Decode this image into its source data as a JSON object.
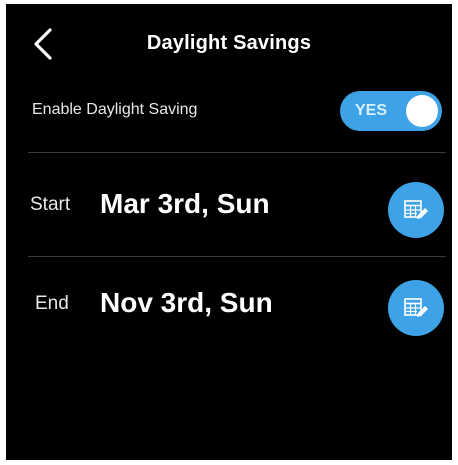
{
  "header": {
    "title": "Daylight Savings",
    "back_icon": "chevron-left-icon"
  },
  "daylight_saving": {
    "label": "Enable Daylight Saving",
    "toggle_text": "YES",
    "enabled": true
  },
  "start": {
    "label": "Start",
    "value": "Mar 3rd, Sun",
    "edit_icon": "calendar-edit-icon"
  },
  "end": {
    "label": "End",
    "value": "Nov 3rd, Sun",
    "edit_icon": "calendar-edit-icon"
  },
  "colors": {
    "background": "#000000",
    "accent": "#3ea2e6",
    "text": "#ffffff"
  }
}
